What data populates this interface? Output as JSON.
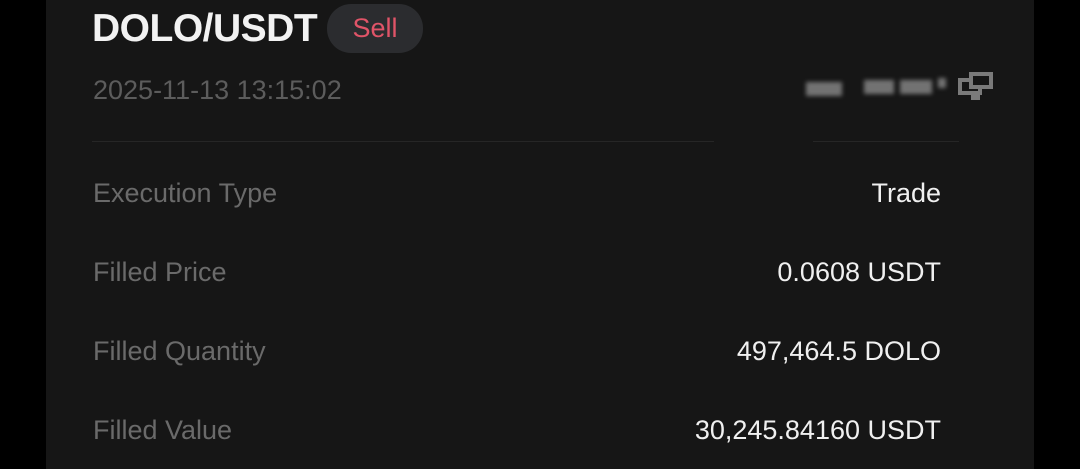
{
  "order": {
    "pair": "DOLO/USDT",
    "side": "Sell",
    "timestamp": "2025-11-13 13:15:02",
    "order_id_redacted": true
  },
  "details": [
    {
      "label": "Execution Type",
      "value": "Trade"
    },
    {
      "label": "Filled Price",
      "value": "0.0608 USDT"
    },
    {
      "label": "Filled Quantity",
      "value": "497,464.5 DOLO"
    },
    {
      "label": "Filled Value",
      "value": "30,245.84160 USDT"
    }
  ],
  "colors": {
    "background": "#161616",
    "sell": "#e05468",
    "label": "#6a6a6a",
    "value": "#f0f0f0"
  },
  "icons": {
    "copy": "copy-icon"
  }
}
